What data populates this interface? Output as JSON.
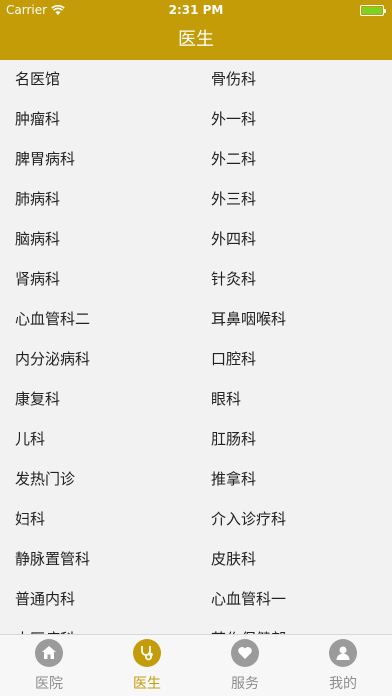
{
  "status": {
    "carrier": "Carrier",
    "time": "2:31 PM",
    "battery_level": 1.0
  },
  "nav": {
    "title": "医生"
  },
  "departments": [
    [
      "名医馆",
      "骨伤科"
    ],
    [
      "肿瘤科",
      "外一科"
    ],
    [
      "脾胃病科",
      "外二科"
    ],
    [
      "肺病科",
      "外三科"
    ],
    [
      "脑病科",
      "外四科"
    ],
    [
      "肾病科",
      "针灸科"
    ],
    [
      "心血管科二",
      "耳鼻咽喉科"
    ],
    [
      "内分泌病科",
      "口腔科"
    ],
    [
      "康复科",
      "眼科"
    ],
    [
      "儿科",
      "肛肠科"
    ],
    [
      "发热门诊",
      "推拿科"
    ],
    [
      "妇科",
      "介入诊疗科"
    ],
    [
      "静脉置管科",
      "皮肤科"
    ],
    [
      "普通内科",
      "心血管科一"
    ],
    [
      "中医病科",
      "芙作保健部"
    ]
  ],
  "tabs": [
    {
      "label": "医院",
      "icon": "home-icon",
      "active": false
    },
    {
      "label": "医生",
      "icon": "stethoscope-icon",
      "active": true
    },
    {
      "label": "服务",
      "icon": "heart-icon",
      "active": false
    },
    {
      "label": "我的",
      "icon": "user-icon",
      "active": false
    }
  ],
  "colors": {
    "accent": "#c39c08",
    "inactive": "#9b9b9b",
    "battery": "#7ed321"
  }
}
